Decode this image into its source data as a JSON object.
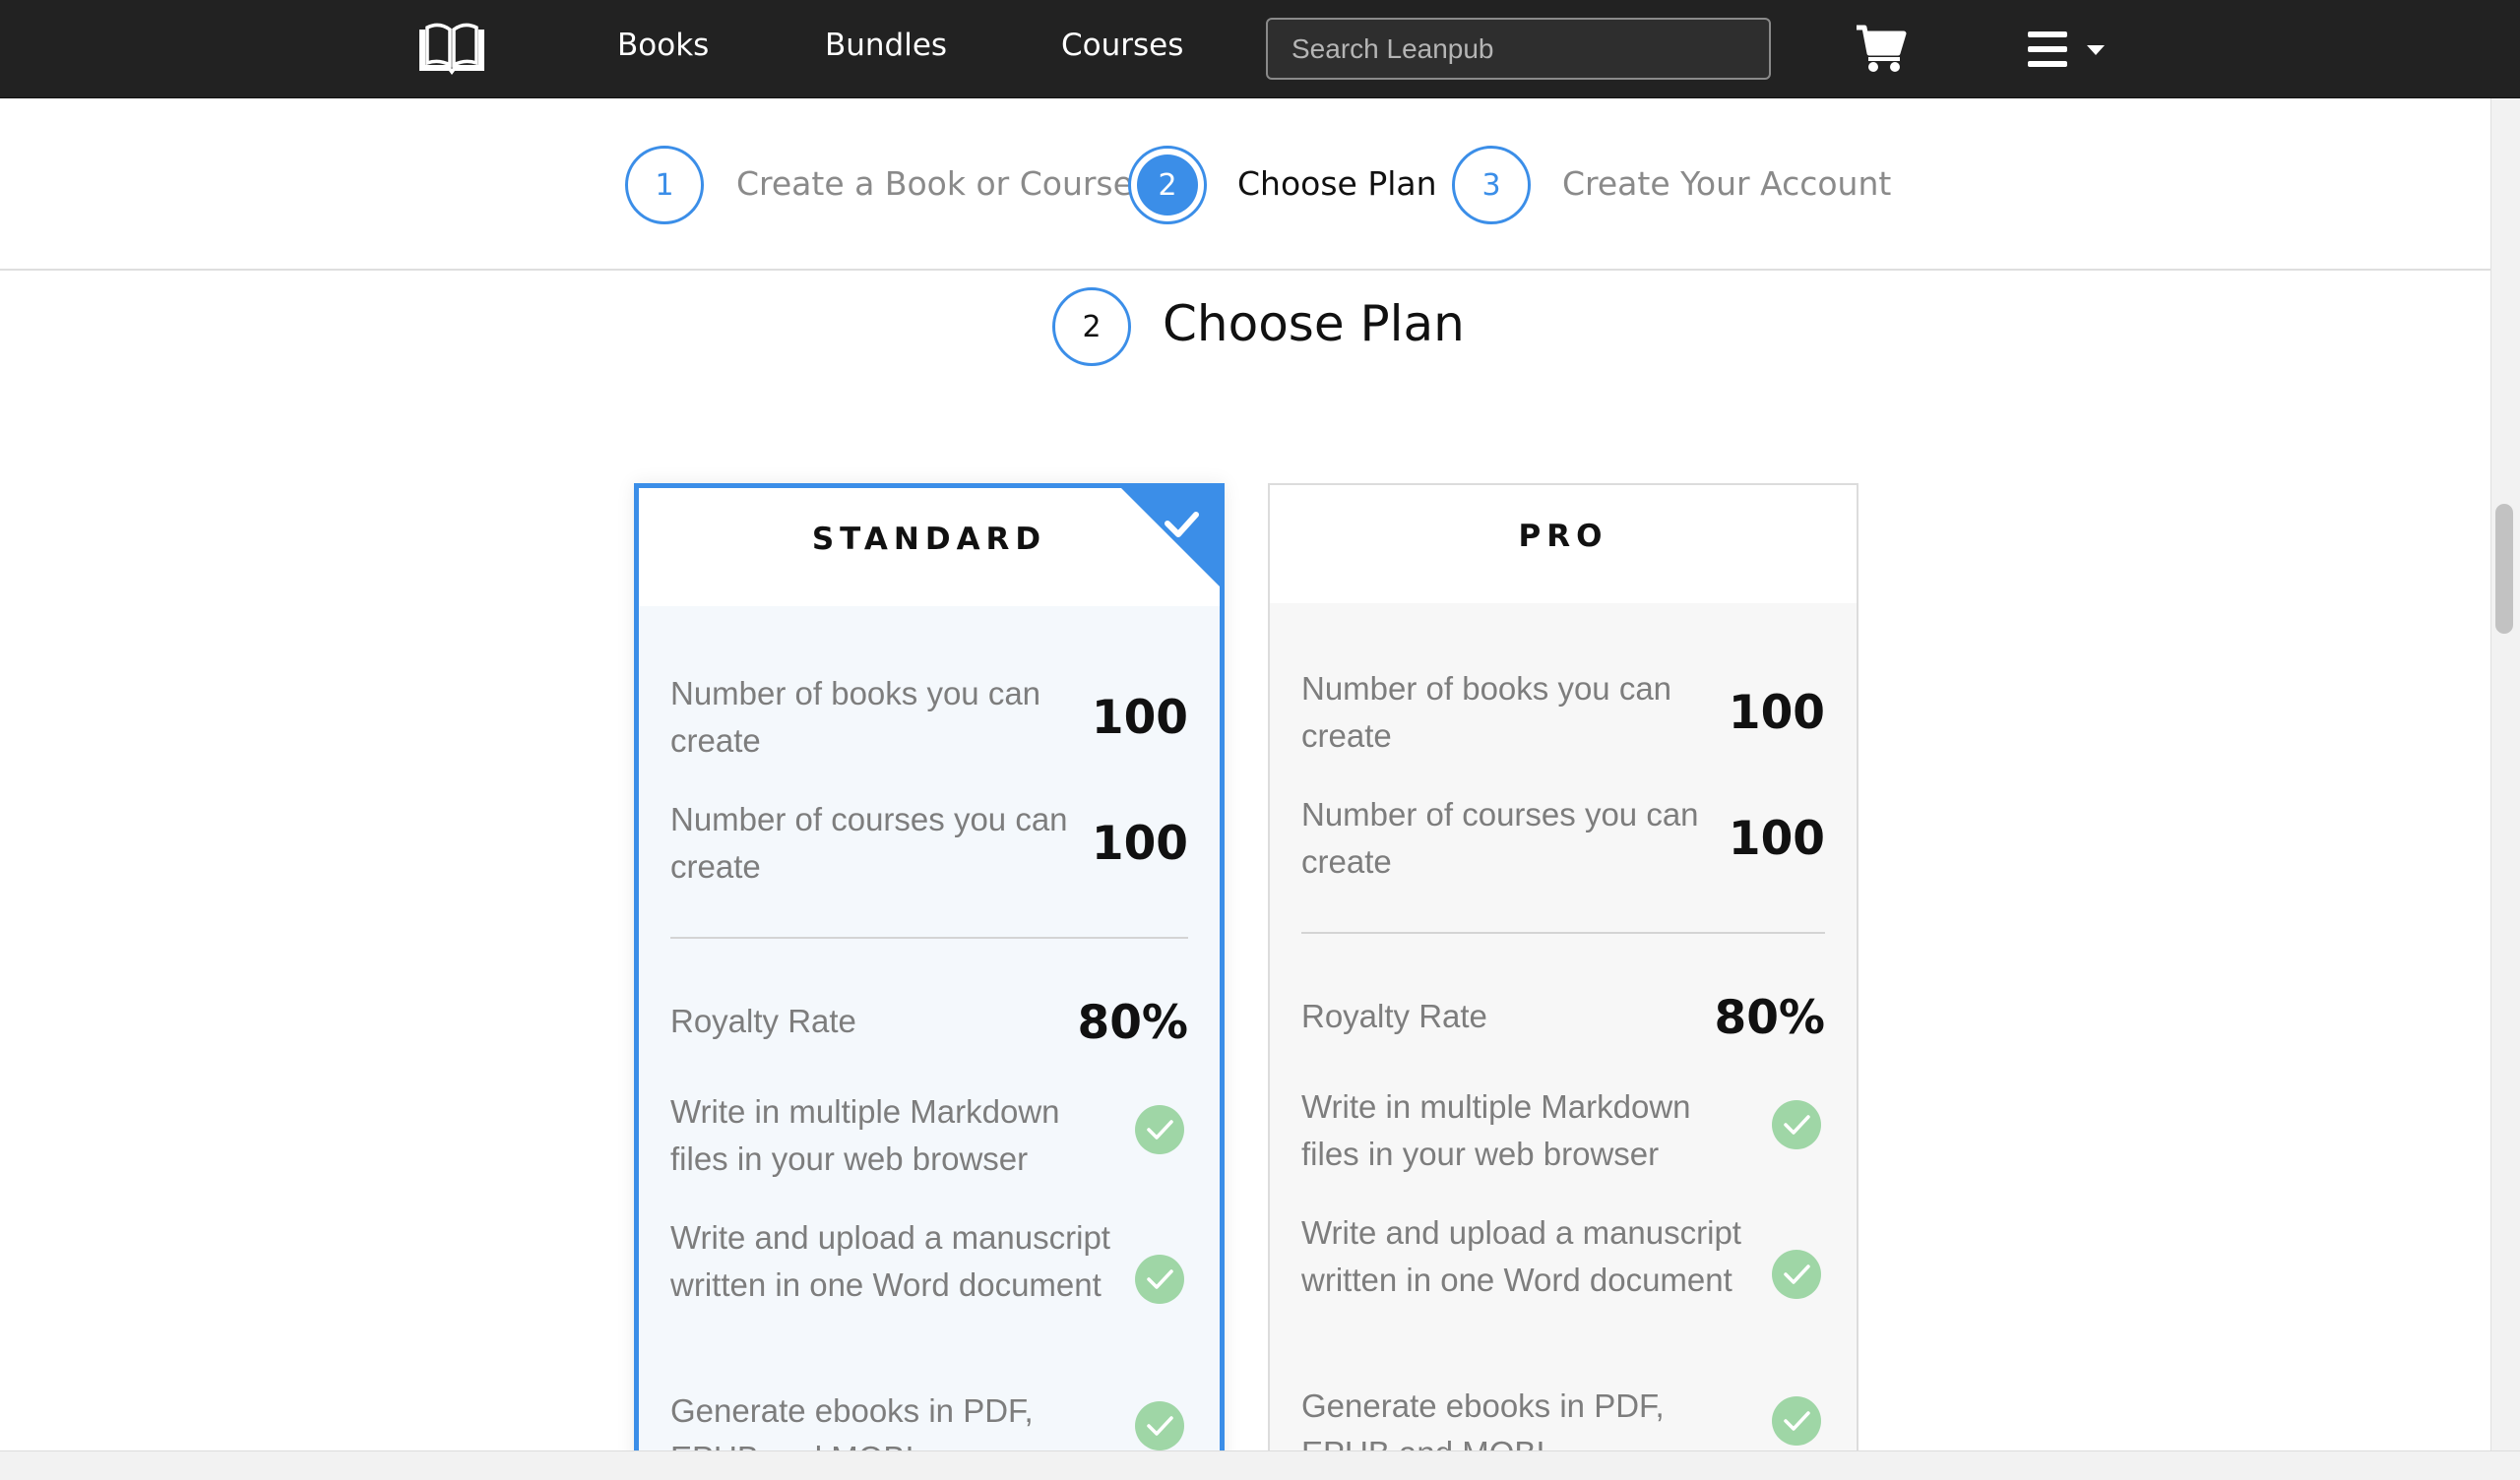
{
  "nav": {
    "logo": "leanpub-book-logo",
    "links": [
      "Books",
      "Bundles",
      "Courses"
    ],
    "search_placeholder": "Search Leanpub",
    "cart_icon": "shopping-cart-icon",
    "menu_icon": "hamburger-menu-icon"
  },
  "stepper": {
    "steps": [
      {
        "number": "1",
        "label": "Create a Book or Course",
        "state": "pending"
      },
      {
        "number": "2",
        "label": "Choose Plan",
        "state": "active"
      },
      {
        "number": "3",
        "label": "Create Your Account",
        "state": "pending"
      }
    ]
  },
  "section": {
    "number": "2",
    "title": "Choose Plan"
  },
  "plans": [
    {
      "name": "STANDARD",
      "selected": true,
      "books_label": "Number of books you can create",
      "books_value": "100",
      "courses_label": "Number of courses you can create",
      "courses_value": "100",
      "royalty_label": "Royalty Rate",
      "royalty_value": "80%",
      "features": [
        "Write in multiple Markdown files in your web browser",
        "Write and upload a manuscript written in one Word document",
        "Generate ebooks in PDF, EPUB and MOBI"
      ]
    },
    {
      "name": "PRO",
      "selected": false,
      "books_label": "Number of books you can create",
      "books_value": "100",
      "courses_label": "Number of courses you can create",
      "courses_value": "100",
      "royalty_label": "Royalty Rate",
      "royalty_value": "80%",
      "features": [
        "Write in multiple Markdown files in your web browser",
        "Write and upload a manuscript written in one Word document",
        "Generate ebooks in PDF, EPUB and MOBI"
      ]
    }
  ],
  "colors": {
    "accent": "#3b8ee8",
    "nav_bg": "#222222",
    "check_green": "#9fd6a6"
  }
}
